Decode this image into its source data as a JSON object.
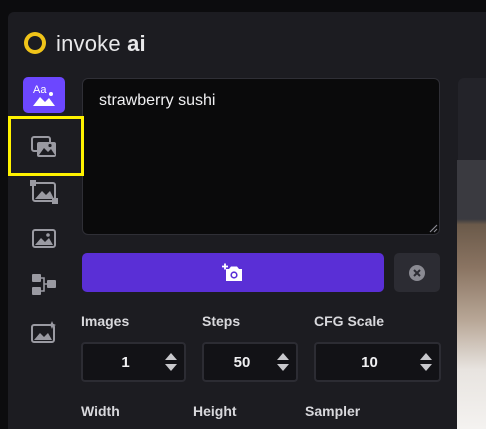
{
  "app": {
    "brand_name": "invoke",
    "brand_suffix": "ai",
    "logo_color": "#f0c419",
    "accent": "#6c47ff"
  },
  "sidebar": {
    "tabs": [
      {
        "name": "text-to-image",
        "icon": "text-to-image-icon",
        "active": true
      },
      {
        "name": "image-to-image",
        "icon": "image-to-image-icon",
        "active": false,
        "highlighted": true
      },
      {
        "name": "unified-canvas",
        "icon": "canvas-icon",
        "active": false
      },
      {
        "name": "inpainting",
        "icon": "inpaint-icon",
        "active": false
      },
      {
        "name": "nodes",
        "icon": "nodes-icon",
        "active": false
      },
      {
        "name": "postprocessing",
        "icon": "postprocess-icon",
        "active": false
      }
    ]
  },
  "prompt": {
    "value": "strawberry sushi"
  },
  "actions": {
    "invoke_icon": "camera-plus-icon",
    "cancel_icon": "cancel-icon"
  },
  "params": {
    "images": {
      "label": "Images",
      "value": "1"
    },
    "steps": {
      "label": "Steps",
      "value": "50"
    },
    "cfg_scale": {
      "label": "CFG Scale",
      "value": "10"
    },
    "width": {
      "label": "Width"
    },
    "height": {
      "label": "Height"
    },
    "sampler": {
      "label": "Sampler"
    }
  }
}
